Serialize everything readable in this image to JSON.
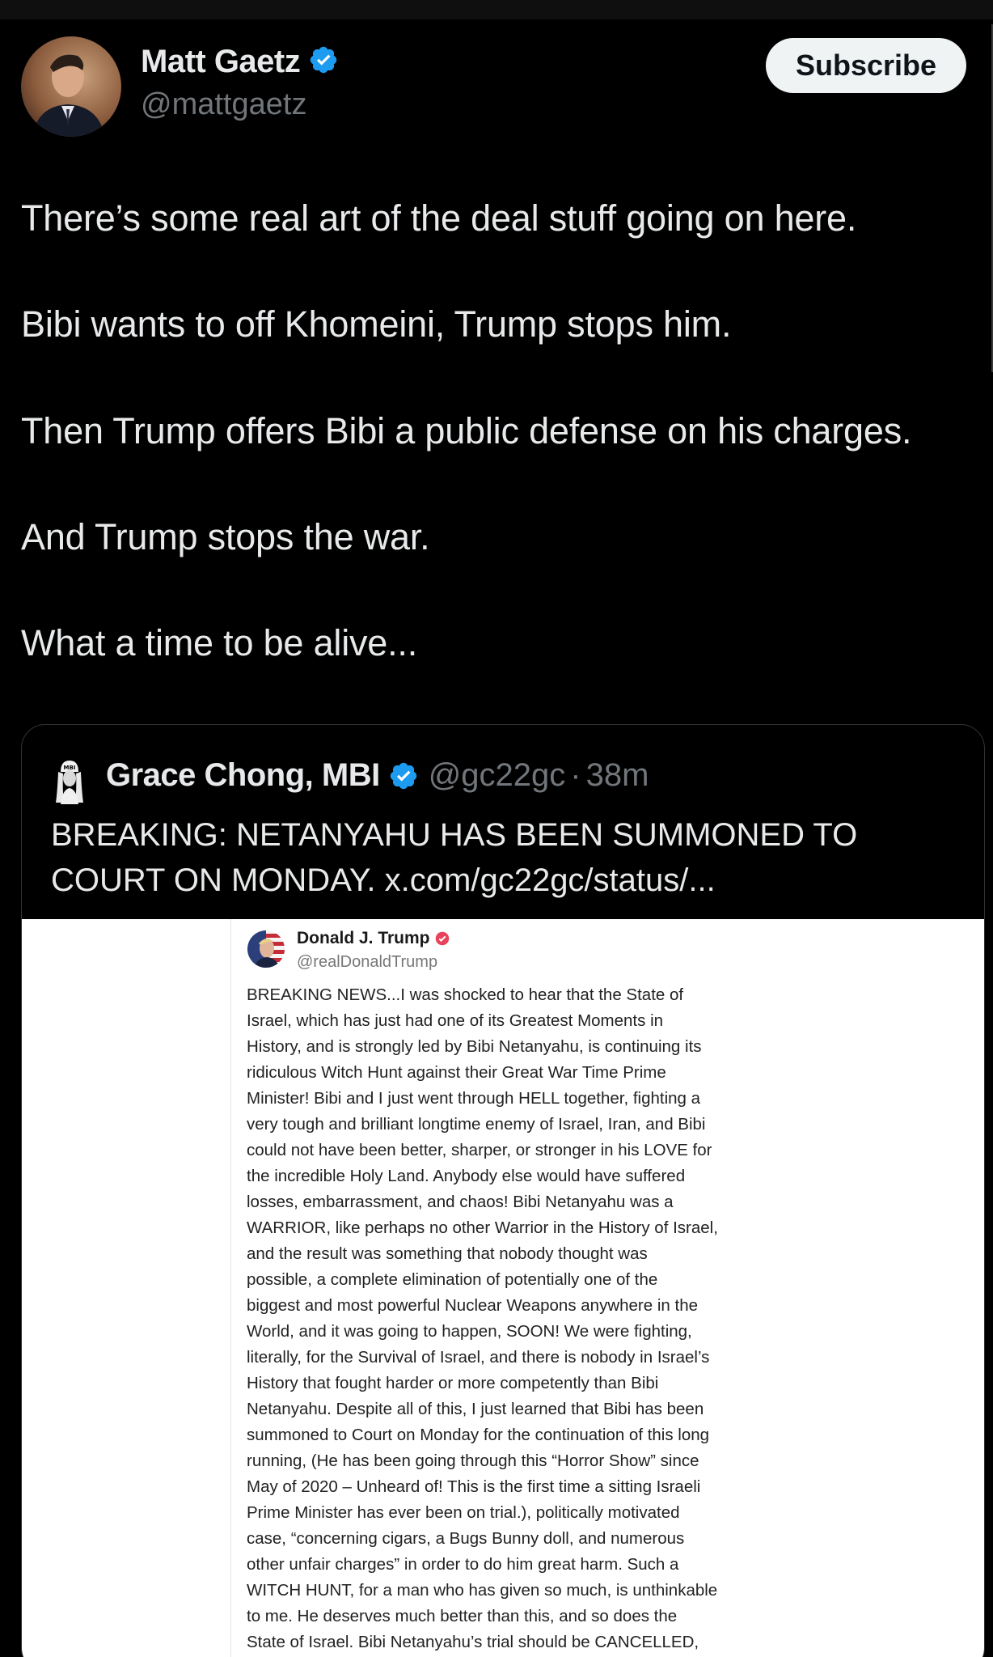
{
  "post": {
    "author_name": "Matt Gaetz",
    "author_handle": "@mattgaetz",
    "subscribe_label": "Subscribe",
    "paragraphs": [
      "There’s some real art of the deal stuff going on here.",
      "Bibi wants to off Khomeini, Trump stops him.",
      "Then Trump offers Bibi a public defense on his charges.",
      "And Trump stops the war.",
      "What a time to be alive..."
    ]
  },
  "quote": {
    "author_name": "Grace Chong, MBI",
    "author_handle": "@gc22gc",
    "separator": "·",
    "time": "38m",
    "text": "BREAKING: NETANYAHU HAS BEEN SUMMONED TO COURT ON MONDAY. x.com/gc22gc/status/..."
  },
  "embedded": {
    "author_name": "Donald J. Trump",
    "author_handle": "@realDonaldTrump",
    "lines": [
      "BREAKING NEWS...I was shocked to hear that the State of",
      "Israel, which has just had one of its Greatest Moments in",
      "History, and is strongly led by Bibi Netanyahu, is continuing its",
      "ridiculous Witch Hunt against their Great War Time Prime",
      "Minister! Bibi and I just went through HELL together, fighting a",
      "very tough and brilliant longtime enemy of Israel, Iran, and Bibi",
      "could not have been better, sharper, or stronger in his LOVE for",
      "the incredible Holy Land. Anybody else would have suffered",
      "losses, embarrassment, and chaos! Bibi Netanyahu was a",
      "WARRIOR, like perhaps no other Warrior in the History of Israel,",
      "and the result was something that nobody thought was",
      "possible, a complete elimination of potentially one of the",
      "biggest and most powerful Nuclear Weapons anywhere in the",
      "World, and it was going to happen, SOON! We were fighting,",
      "literally, for the Survival of Israel, and there is nobody in Israel’s",
      "History that fought harder or more competently than Bibi",
      "Netanyahu. Despite all of this, I just learned that Bibi has been",
      "summoned to Court on Monday for the continuation of this long",
      "running, (He has been going through this “Horror Show” since",
      "May of 2020 – Unheard of! This is the first time a sitting Israeli",
      "Prime Minister has ever been on trial.), politically motivated",
      "case, “concerning cigars, a Bugs Bunny doll, and numerous",
      "other unfair charges” in order to do him great harm. Such a",
      "WITCH HUNT, for a man who has given so much, is unthinkable",
      "to me. He deserves much better than this, and so does the",
      "State of Israel. Bibi Netanyahu’s trial should be CANCELLED,"
    ]
  },
  "colors": {
    "background": "#000000",
    "text_primary": "#e7e9ea",
    "text_secondary": "#71767b",
    "verified_blue": "#1d9bf0",
    "truth_badge_red": "#e8435a"
  },
  "icons": {
    "verified": "verified-badge-icon",
    "truth_verified": "truth-verified-badge-icon"
  }
}
